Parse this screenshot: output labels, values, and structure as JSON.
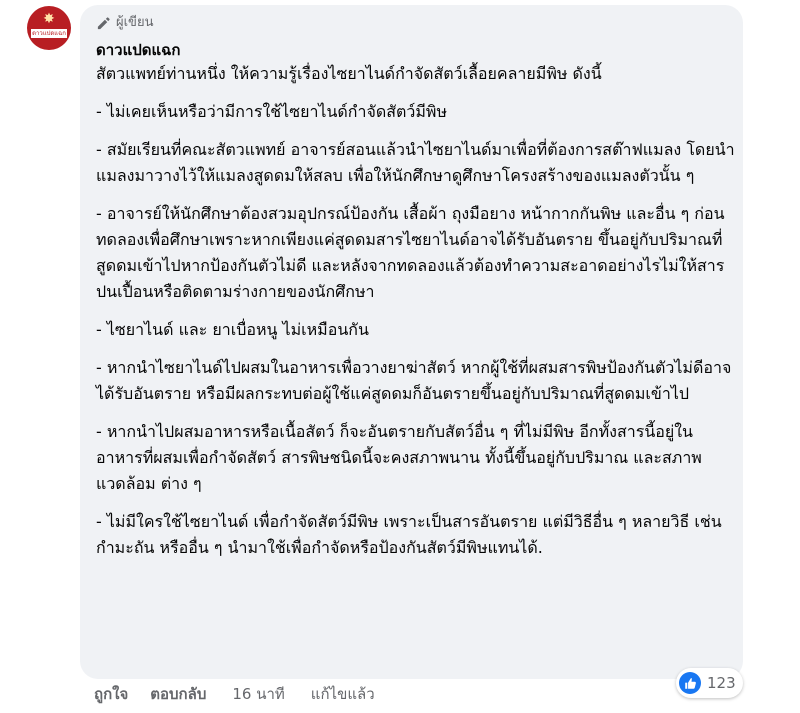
{
  "author": {
    "badge_label": "ผู้เขียน",
    "name": "ดาวแปดแฉก",
    "avatar_text": "ดาวแปดแฉก"
  },
  "comment": {
    "paragraphs": [
      "สัตวแพทย์ท่านหนึ่ง ให้ความรู้เรื่องไซยาไนด์กำจัดสัตว์เลื้อยคลายมีพิษ ดังนี้",
      "- ไม่เคยเห็นหรือว่ามีการใช้ไซยาไนด์กำจัดสัตว์มีพิษ",
      "- สมัยเรียนที่คณะสัตวแพทย์ อาจารย์สอนแล้วนำไซยาไนด์มาเพื่อที่ต้องการสต๊าฟแมลง โดยนำแมลงมาวางไว้ให้แมลงสูดดมให้สลบ เพื่อให้นักศึกษาดูศึกษาโครงสร้างของแมลงตัวนั้น ๆ",
      "- อาจารย์ให้นักศึกษาต้องสวมอุปกรณ์ป้องกัน เสื้อผ้า ถุงมือยาง หน้ากากกันพิษ และอื่น ๆ ก่อนทดลองเพื่อศึกษาเพราะหากเพียงแค่สูดดมสารไซยาไนด์อาจได้รับอันตราย ขึ้นอยู่กับปริมาณที่สูดดมเข้าไปหากป้องกันตัวไม่ดี และหลังจากทดลองแล้วต้องทำความสะอาดอย่างไรไม่ให้สารปนเปื้อนหรือติดตามร่างกายของนักศึกษา",
      "- ไซยาไนด์ และ ยาเบื่อหนู ไม่เหมือนกัน",
      "- หากนำไซยาไนด์ไปผสมในอาหารเพื่อวางยาฆ่าสัตว์ หากผู้ใช้ที่ผสมสารพิษป้องกันตัวไม่ดีอาจได้รับอันตราย หรือมีผลกระทบต่อผู้ใช้แค่สูดดมก็อันตรายขึ้นอยู่กับปริมาณที่สูดดมเข้าไป",
      "- หากนำไปผสมอาหารหรือเนื้อสัตว์ ก็จะอันตรายกับสัตว์อื่น ๆ ที่ไม่มีพิษ อีกทั้งสารนี้อยู่ในอาหารที่ผสมเพื่อกำจัดสัตว์ สารพิษชนิดนี้จะคงสภาพนาน ทั้งนี้ขึ้นอยู่กับปริมาณ และสภาพแวดล้อม ต่าง ๆ",
      "- ไม่มีใครใช้ไซยาไนด์ เพื่อกำจัดสัตว์มีพิษ เพราะเป็นสารอันตราย แต่มีวิธีอื่น ๆ หลายวิธี เช่น กำมะถัน หรืออื่น ๆ นำมาใช้เพื่อกำจัดหรือป้องกันสัตว์มีพิษแทนได้."
    ]
  },
  "actions": {
    "like": "ถูกใจ",
    "reply": "ตอบกลับ",
    "time": "16 นาที",
    "edited": "แก้ไขแล้ว"
  },
  "reactions": {
    "count": "123",
    "icon": "like-icon",
    "color": "#1877f2"
  },
  "colors": {
    "bubble": "#f0f2f5",
    "avatar": "#b81e23",
    "secondary_text": "#65676b"
  }
}
